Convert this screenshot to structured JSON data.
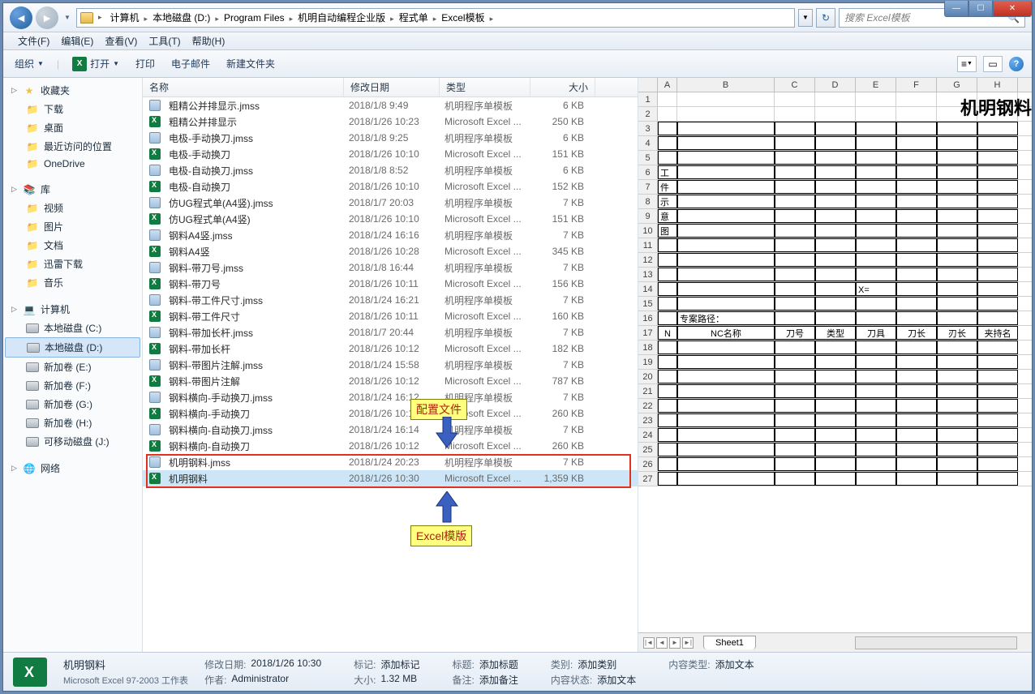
{
  "window": {
    "minimize": "—",
    "maximize": "☐",
    "close": "✕"
  },
  "nav": {
    "back": "◄",
    "forward": "►",
    "dropdown": "▼",
    "refresh": "↻",
    "breadcrumbs": [
      "计算机",
      "本地磁盘 (D:)",
      "Program Files",
      "机明自动编程企业版",
      "程式单",
      "Excel模板"
    ],
    "search_placeholder": "搜索 Excel模板"
  },
  "menu": [
    "文件(F)",
    "编辑(E)",
    "查看(V)",
    "工具(T)",
    "帮助(H)"
  ],
  "toolbar": {
    "organize": "组织",
    "open": "打开",
    "print": "打印",
    "email": "电子邮件",
    "newfolder": "新建文件夹"
  },
  "sidebar": {
    "favorites": {
      "label": "收藏夹",
      "items": [
        "下载",
        "桌面",
        "最近访问的位置",
        "OneDrive"
      ]
    },
    "libraries": {
      "label": "库",
      "items": [
        "视频",
        "图片",
        "文档",
        "迅雷下载",
        "音乐"
      ]
    },
    "computer": {
      "label": "计算机",
      "items": [
        "本地磁盘 (C:)",
        "本地磁盘 (D:)",
        "新加卷 (E:)",
        "新加卷 (F:)",
        "新加卷 (G:)",
        "新加卷 (H:)",
        "可移动磁盘 (J:)"
      ]
    },
    "network": {
      "label": "网络"
    }
  },
  "columns": {
    "name": "名称",
    "date": "修改日期",
    "type": "类型",
    "size": "大小"
  },
  "files": [
    {
      "ico": "jmss",
      "name": "粗精公并排显示.jmss",
      "date": "2018/1/8 9:49",
      "type": "机明程序单模板",
      "size": "6 KB"
    },
    {
      "ico": "xls",
      "name": "粗精公并排显示",
      "date": "2018/1/26 10:23",
      "type": "Microsoft Excel ...",
      "size": "250 KB"
    },
    {
      "ico": "jmss",
      "name": "电极-手动换刀.jmss",
      "date": "2018/1/8 9:25",
      "type": "机明程序单模板",
      "size": "6 KB"
    },
    {
      "ico": "xls",
      "name": "电极-手动换刀",
      "date": "2018/1/26 10:10",
      "type": "Microsoft Excel ...",
      "size": "151 KB"
    },
    {
      "ico": "jmss",
      "name": "电极-自动换刀.jmss",
      "date": "2018/1/8 8:52",
      "type": "机明程序单模板",
      "size": "6 KB"
    },
    {
      "ico": "xls",
      "name": "电极-自动换刀",
      "date": "2018/1/26 10:10",
      "type": "Microsoft Excel ...",
      "size": "152 KB"
    },
    {
      "ico": "jmss",
      "name": "仿UG程式单(A4竖).jmss",
      "date": "2018/1/7 20:03",
      "type": "机明程序单模板",
      "size": "7 KB"
    },
    {
      "ico": "xls",
      "name": "仿UG程式单(A4竖)",
      "date": "2018/1/26 10:10",
      "type": "Microsoft Excel ...",
      "size": "151 KB"
    },
    {
      "ico": "jmss",
      "name": "钢料A4竖.jmss",
      "date": "2018/1/24 16:16",
      "type": "机明程序单模板",
      "size": "7 KB"
    },
    {
      "ico": "xls",
      "name": "钢料A4竖",
      "date": "2018/1/26 10:28",
      "type": "Microsoft Excel ...",
      "size": "345 KB"
    },
    {
      "ico": "jmss",
      "name": "钢料-带刀号.jmss",
      "date": "2018/1/8 16:44",
      "type": "机明程序单模板",
      "size": "7 KB"
    },
    {
      "ico": "xls",
      "name": "钢料-带刀号",
      "date": "2018/1/26 10:11",
      "type": "Microsoft Excel ...",
      "size": "156 KB"
    },
    {
      "ico": "jmss",
      "name": "钢料-带工件尺寸.jmss",
      "date": "2018/1/24 16:21",
      "type": "机明程序单模板",
      "size": "7 KB"
    },
    {
      "ico": "xls",
      "name": "钢料-带工件尺寸",
      "date": "2018/1/26 10:11",
      "type": "Microsoft Excel ...",
      "size": "160 KB"
    },
    {
      "ico": "jmss",
      "name": "钢料-带加长杆.jmss",
      "date": "2018/1/7 20:44",
      "type": "机明程序单模板",
      "size": "7 KB"
    },
    {
      "ico": "xls",
      "name": "钢料-带加长杆",
      "date": "2018/1/26 10:12",
      "type": "Microsoft Excel ...",
      "size": "182 KB"
    },
    {
      "ico": "jmss",
      "name": "钢料-带图片注解.jmss",
      "date": "2018/1/24 15:58",
      "type": "机明程序单模板",
      "size": "7 KB"
    },
    {
      "ico": "xls",
      "name": "钢料-带图片注解",
      "date": "2018/1/26 10:12",
      "type": "Microsoft Excel ...",
      "size": "787 KB"
    },
    {
      "ico": "jmss",
      "name": "钢料横向-手动换刀.jmss",
      "date": "2018/1/24 16:12",
      "type": "机明程序单模板",
      "size": "7 KB"
    },
    {
      "ico": "xls",
      "name": "钢料横向-手动换刀",
      "date": "2018/1/26 10:12",
      "type": "Microsoft Excel ...",
      "size": "260 KB"
    },
    {
      "ico": "jmss",
      "name": "钢料横向-自动换刀.jmss",
      "date": "2018/1/24 16:14",
      "type": "机明程序单模板",
      "size": "7 KB"
    },
    {
      "ico": "xls",
      "name": "钢料横向-自动换刀",
      "date": "2018/1/26 10:12",
      "type": "Microsoft Excel ...",
      "size": "260 KB"
    },
    {
      "ico": "jmss",
      "name": "机明钢料.jmss",
      "date": "2018/1/24 20:23",
      "type": "机明程序单模板",
      "size": "7 KB"
    },
    {
      "ico": "xls",
      "name": "机明钢料",
      "date": "2018/1/26 10:30",
      "type": "Microsoft Excel ...",
      "size": "1,359 KB",
      "sel": true
    }
  ],
  "file_selected_index": 23,
  "annotations": {
    "config_label": "配置文件",
    "excel_label": "Excel模版"
  },
  "preview": {
    "title": "机明钢料",
    "cols": [
      "A",
      "B",
      "C",
      "D",
      "E",
      "F",
      "G",
      "H"
    ],
    "vertical_text": [
      "工",
      "件",
      "示",
      "意",
      "图"
    ],
    "path_label": "专案路径：",
    "x_eq": "X=",
    "headers": [
      "N",
      "NC名称",
      "刀号",
      "类型",
      "刀具",
      "刀长",
      "刃长",
      "夹持名"
    ],
    "sheet": "Sheet1"
  },
  "status": {
    "name": "机明钢料",
    "type": "Microsoft Excel 97-2003 工作表",
    "pairs": [
      {
        "lbl": "修改日期:",
        "val": "2018/1/26 10:30",
        "lbl2": "作者:",
        "val2": "Administrator"
      },
      {
        "lbl": "标记:",
        "val": "添加标记",
        "lbl2": "大小:",
        "val2": "1.32 MB"
      },
      {
        "lbl": "标题:",
        "val": "添加标题",
        "lbl2": "备注:",
        "val2": "添加备注"
      },
      {
        "lbl": "类别:",
        "val": "添加类别",
        "lbl2": "内容状态:",
        "val2": "添加文本"
      },
      {
        "lbl": "内容类型:",
        "val": "添加文本"
      }
    ]
  }
}
